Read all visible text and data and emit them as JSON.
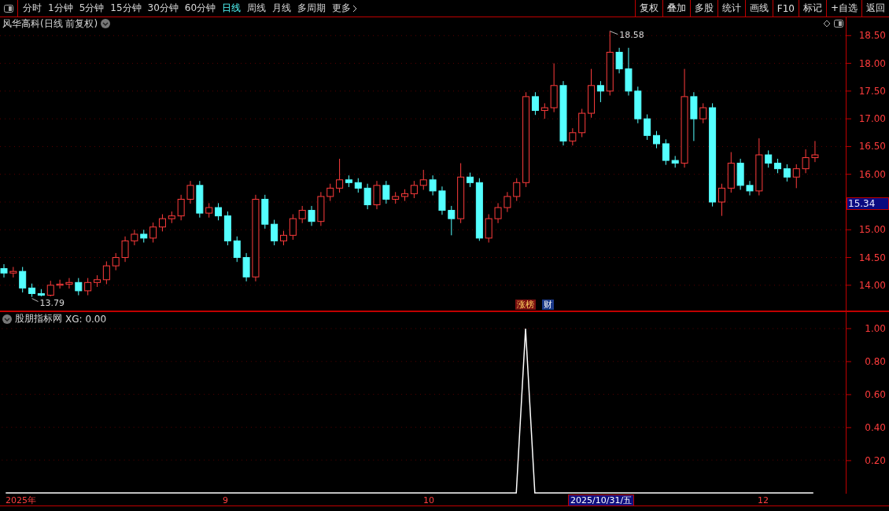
{
  "toolbar": {
    "tabs": [
      {
        "label": "分时",
        "selected": false
      },
      {
        "label": "1分钟",
        "selected": false
      },
      {
        "label": "5分钟",
        "selected": false
      },
      {
        "label": "15分钟",
        "selected": false
      },
      {
        "label": "30分钟",
        "selected": false
      },
      {
        "label": "60分钟",
        "selected": false
      },
      {
        "label": "日线",
        "selected": true
      },
      {
        "label": "周线",
        "selected": false
      },
      {
        "label": "月线",
        "selected": false
      },
      {
        "label": "多周期",
        "selected": false
      }
    ],
    "more": "更多",
    "buttons": [
      "复权",
      "叠加",
      "多股",
      "统计",
      "画线",
      "F10",
      "标记",
      "+自选",
      "返回"
    ]
  },
  "main_chart": {
    "title": "风华高科(日线 前复权)",
    "high_marker": "18.58",
    "low_marker": "13.79",
    "badges": [
      {
        "label": "涨榜",
        "kind": "limit"
      },
      {
        "label": "财",
        "kind": "finance"
      }
    ],
    "current_price": "15.34",
    "chart_data": {
      "type": "candlestick",
      "grid": true,
      "ylim": [
        13.53,
        18.83
      ],
      "yticks": [
        {
          "value": 18.5,
          "label": "18.50"
        },
        {
          "value": 18,
          "label": "18.00"
        },
        {
          "value": 17.5,
          "label": "17.50"
        },
        {
          "value": 17,
          "label": "17.00"
        },
        {
          "value": 16.5,
          "label": "16.50"
        },
        {
          "value": 16,
          "label": "16.00"
        },
        {
          "value": 15,
          "label": "15.00"
        },
        {
          "value": 14.5,
          "label": "14.50"
        },
        {
          "value": 14,
          "label": "14.00"
        }
      ],
      "ohlc": [
        [
          14.3,
          14.38,
          14.14,
          14.22
        ],
        [
          14.22,
          14.33,
          14.14,
          14.25
        ],
        [
          14.25,
          14.33,
          13.87,
          13.95
        ],
        [
          13.95,
          14.03,
          13.79,
          13.85
        ],
        [
          13.85,
          13.93,
          13.8,
          13.82
        ],
        [
          13.82,
          14.08,
          13.8,
          14.0
        ],
        [
          14.0,
          14.1,
          13.94,
          14.02
        ],
        [
          14.02,
          14.13,
          13.94,
          14.05
        ],
        [
          14.05,
          14.13,
          13.82,
          13.9
        ],
        [
          13.9,
          14.13,
          13.82,
          14.05
        ],
        [
          14.05,
          14.18,
          13.97,
          14.1
        ],
        [
          14.1,
          14.43,
          14.02,
          14.35
        ],
        [
          14.35,
          14.58,
          14.27,
          14.5
        ],
        [
          14.5,
          14.88,
          14.42,
          14.8
        ],
        [
          14.8,
          15.0,
          14.72,
          14.92
        ],
        [
          14.92,
          15.0,
          14.77,
          14.85
        ],
        [
          14.85,
          15.13,
          14.77,
          15.05
        ],
        [
          15.05,
          15.28,
          14.97,
          15.2
        ],
        [
          15.2,
          15.33,
          15.12,
          15.25
        ],
        [
          15.25,
          15.63,
          15.17,
          15.55
        ],
        [
          15.55,
          15.88,
          15.47,
          15.8
        ],
        [
          15.8,
          15.88,
          15.22,
          15.3
        ],
        [
          15.3,
          15.48,
          15.22,
          15.4
        ],
        [
          15.4,
          15.48,
          15.17,
          15.25
        ],
        [
          15.25,
          15.33,
          14.72,
          14.8
        ],
        [
          14.8,
          14.88,
          14.42,
          14.5
        ],
        [
          14.5,
          14.58,
          14.07,
          14.15
        ],
        [
          14.15,
          15.63,
          14.07,
          15.55
        ],
        [
          15.55,
          15.63,
          15.02,
          15.1
        ],
        [
          15.1,
          15.18,
          14.72,
          14.8
        ],
        [
          14.8,
          14.98,
          14.72,
          14.9
        ],
        [
          14.9,
          15.28,
          14.82,
          15.2
        ],
        [
          15.2,
          15.43,
          15.12,
          15.35
        ],
        [
          15.35,
          15.43,
          15.07,
          15.15
        ],
        [
          15.15,
          15.68,
          15.07,
          15.6
        ],
        [
          15.6,
          15.83,
          15.52,
          15.75
        ],
        [
          15.75,
          16.28,
          15.67,
          15.9
        ],
        [
          15.9,
          15.98,
          15.77,
          15.85
        ],
        [
          15.85,
          15.93,
          15.67,
          15.75
        ],
        [
          15.75,
          15.83,
          15.37,
          15.45
        ],
        [
          15.45,
          15.88,
          15.37,
          15.8
        ],
        [
          15.8,
          15.88,
          15.47,
          15.55
        ],
        [
          15.55,
          15.68,
          15.47,
          15.6
        ],
        [
          15.6,
          15.73,
          15.52,
          15.65
        ],
        [
          15.65,
          15.88,
          15.57,
          15.8
        ],
        [
          15.8,
          16.08,
          15.72,
          15.9
        ],
        [
          15.9,
          15.98,
          15.62,
          15.7
        ],
        [
          15.7,
          15.78,
          15.27,
          15.35
        ],
        [
          15.35,
          15.43,
          14.9,
          15.2
        ],
        [
          15.2,
          16.2,
          15.12,
          15.95
        ],
        [
          15.95,
          16.03,
          15.77,
          15.85
        ],
        [
          15.85,
          15.93,
          14.8,
          14.85
        ],
        [
          14.85,
          15.28,
          14.77,
          15.2
        ],
        [
          15.2,
          15.48,
          15.12,
          15.4
        ],
        [
          15.4,
          15.68,
          15.32,
          15.6
        ],
        [
          15.6,
          15.93,
          15.52,
          15.85
        ],
        [
          15.85,
          17.48,
          15.77,
          17.4
        ],
        [
          17.4,
          17.48,
          17.07,
          17.15
        ],
        [
          17.15,
          17.28,
          17.0,
          17.2
        ],
        [
          17.2,
          18.0,
          17.12,
          17.6
        ],
        [
          17.6,
          17.68,
          16.52,
          16.6
        ],
        [
          16.6,
          16.83,
          16.52,
          16.75
        ],
        [
          16.75,
          17.18,
          16.67,
          17.1
        ],
        [
          17.1,
          17.9,
          17.02,
          17.6
        ],
        [
          17.6,
          17.68,
          17.3,
          17.5
        ],
        [
          17.5,
          18.58,
          17.42,
          18.2
        ],
        [
          18.2,
          18.28,
          17.82,
          17.9
        ],
        [
          17.9,
          18.28,
          17.42,
          17.5
        ],
        [
          17.5,
          17.58,
          16.92,
          17.0
        ],
        [
          17.0,
          17.08,
          16.62,
          16.7
        ],
        [
          16.7,
          16.78,
          16.47,
          16.55
        ],
        [
          16.55,
          16.63,
          16.17,
          16.25
        ],
        [
          16.25,
          16.33,
          16.12,
          16.2
        ],
        [
          16.2,
          17.9,
          16.12,
          17.4
        ],
        [
          17.4,
          17.48,
          16.6,
          17.0
        ],
        [
          17.0,
          17.28,
          16.92,
          17.2
        ],
        [
          17.2,
          17.28,
          15.42,
          15.5
        ],
        [
          15.5,
          15.83,
          15.25,
          15.75
        ],
        [
          15.75,
          16.4,
          15.67,
          16.2
        ],
        [
          16.2,
          16.28,
          15.72,
          15.8
        ],
        [
          15.8,
          15.88,
          15.62,
          15.7
        ],
        [
          15.7,
          16.65,
          15.62,
          16.35
        ],
        [
          16.35,
          16.43,
          16.12,
          16.2
        ],
        [
          16.2,
          16.28,
          16.02,
          16.1
        ],
        [
          16.1,
          16.18,
          15.87,
          15.95
        ],
        [
          15.95,
          16.18,
          15.75,
          16.1
        ],
        [
          16.1,
          16.45,
          16.02,
          16.3
        ],
        [
          16.3,
          16.6,
          16.22,
          16.35
        ]
      ]
    }
  },
  "indicator": {
    "title": "股朋指标网",
    "reading": ": 0.00",
    "chart_data": {
      "type": "line",
      "grid": true,
      "ylim": [
        -0.01,
        1.1
      ],
      "yticks": [
        {
          "value": 1,
          "label": "1.00"
        },
        {
          "value": 0.8,
          "label": "0.80"
        },
        {
          "value": 0.6,
          "label": "0.60"
        },
        {
          "value": 0.4,
          "label": "0.40"
        },
        {
          "value": 0.2,
          "label": "0.20"
        }
      ],
      "series": [
        {
          "name": "XG",
          "color": "#ffffff",
          "values": [
            0,
            0,
            0,
            0,
            0,
            0,
            0,
            0,
            0,
            0,
            0,
            0,
            0,
            0,
            0,
            0,
            0,
            0,
            0,
            0,
            0,
            0,
            0,
            0,
            0,
            0,
            0,
            0,
            0,
            0,
            0,
            0,
            0,
            0,
            0,
            0,
            0,
            0,
            0,
            0,
            0,
            0,
            0,
            0,
            0,
            0,
            0,
            0,
            0,
            0,
            0,
            0,
            0,
            0,
            0,
            0,
            1,
            0,
            0,
            0,
            0,
            0,
            0,
            0,
            0,
            0,
            0,
            0,
            0,
            0,
            0,
            0,
            0,
            0,
            0,
            0,
            0,
            0,
            0,
            0,
            0,
            0,
            0,
            0,
            0,
            0,
            0,
            0
          ]
        }
      ]
    }
  },
  "date_axis": [
    {
      "label": "2025年",
      "highlighted": false
    },
    {
      "label": "9",
      "highlighted": false
    },
    {
      "label": "10",
      "highlighted": false
    },
    {
      "label": "2025/10/31/五",
      "highlighted": true
    },
    {
      "label": "12",
      "highlighted": false
    }
  ]
}
